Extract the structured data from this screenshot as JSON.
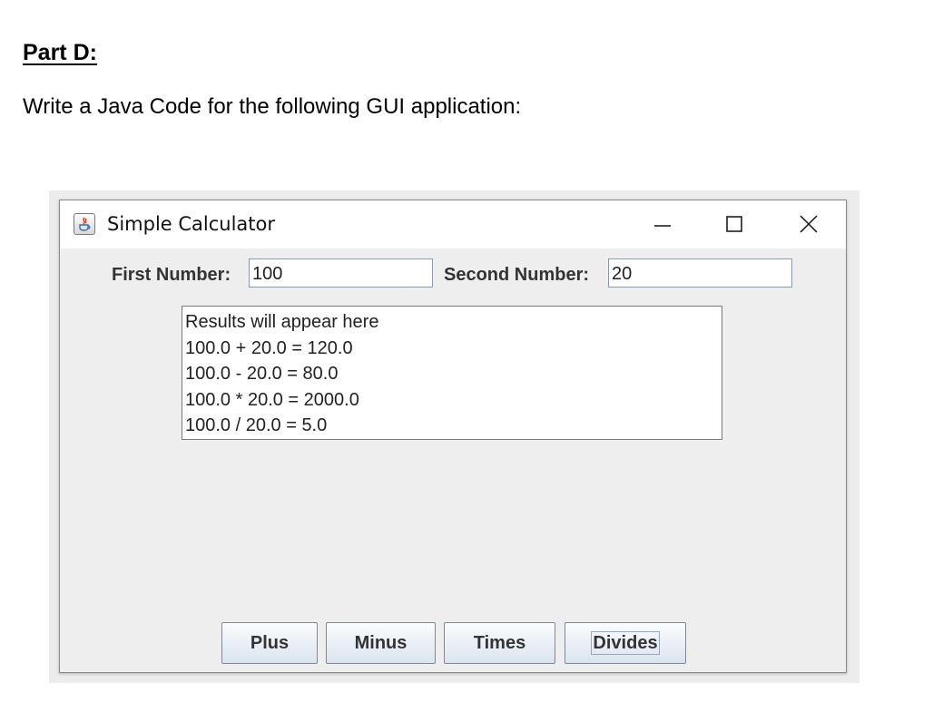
{
  "document": {
    "heading": "Part D:",
    "instruction": "Write a Java Code for the following GUI application:"
  },
  "window": {
    "title": "Simple Calculator",
    "app_icon": "java-icon",
    "controls": {
      "minimize": "minimize-icon",
      "maximize": "maximize-icon",
      "close": "close-icon"
    }
  },
  "form": {
    "first_label": "First Number:",
    "first_value": "100",
    "second_label": "Second Number:",
    "second_value": "20"
  },
  "results": {
    "lines": [
      "Results will appear here",
      "100.0 + 20.0 = 120.0",
      "100.0 - 20.0 = 80.0",
      "100.0 * 20.0 = 2000.0",
      "100.0 / 20.0 = 5.0"
    ]
  },
  "buttons": {
    "plus": "Plus",
    "minus": "Minus",
    "times": "Times",
    "divides": "Divides"
  }
}
